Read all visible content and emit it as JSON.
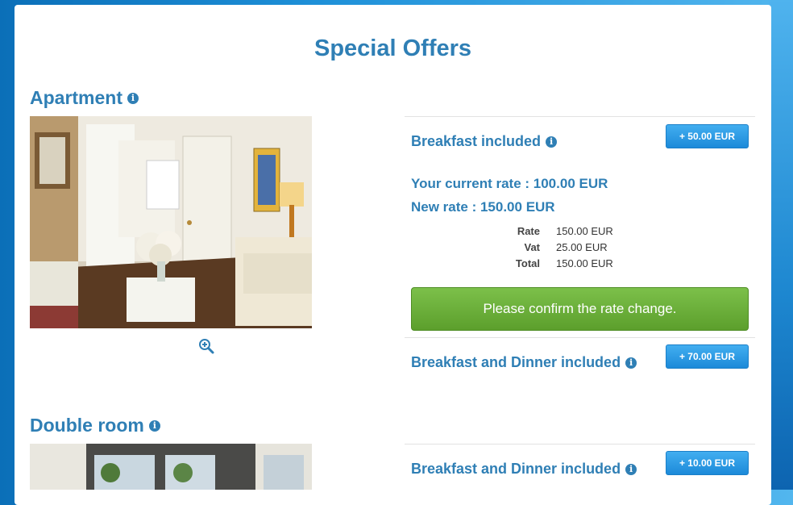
{
  "page": {
    "title": "Special Offers"
  },
  "rooms": [
    {
      "name": "Apartment",
      "offers": [
        {
          "name": "Breakfast included",
          "price": "+ 50.00 EUR"
        },
        {
          "name": "Breakfast and Dinner included",
          "price": "+ 70.00 EUR"
        }
      ],
      "selection": {
        "current_rate": "Your current rate : 100.00 EUR",
        "new_rate": "New rate : 150.00 EUR",
        "breakdown": [
          {
            "label": "Rate",
            "value": "150.00 EUR"
          },
          {
            "label": "Vat",
            "value": "25.00 EUR"
          },
          {
            "label": "Total",
            "value": "150.00 EUR"
          }
        ],
        "confirm_label": "Please confirm the rate change."
      }
    },
    {
      "name": "Double room",
      "offers": [
        {
          "name": "Breakfast and Dinner included",
          "price": "+ 10.00 EUR"
        }
      ]
    }
  ],
  "icons": {
    "info": "info-icon",
    "zoom": "zoom-in-icon"
  },
  "colors": {
    "heading": "#2f7fb5",
    "price_button": "#1c8ad9",
    "confirm_button": "#6aae36"
  }
}
